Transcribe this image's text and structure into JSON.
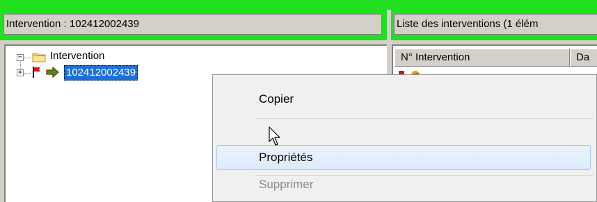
{
  "left_header": {
    "text": "Intervention : 102412002439"
  },
  "right_header": {
    "text": "Liste des interventions  (1 élém"
  },
  "tree": {
    "root_label": "Intervention",
    "child_label": "102412002439"
  },
  "list": {
    "columns": [
      "N° Intervention",
      "Da"
    ]
  },
  "context_menu": {
    "items": [
      {
        "label": "Copier",
        "enabled": true
      },
      {
        "label": "Propriétés",
        "enabled": true
      },
      {
        "label": "Supprimer",
        "enabled": false
      }
    ]
  },
  "icons": {
    "folder": "folder-icon",
    "flag": "red-flag-icon",
    "arrow": "green-arrow-icon",
    "cursor": "mouse-cursor-icon"
  },
  "colors": {
    "accent_green": "#20e020",
    "selection_blue": "#1c6fd9"
  }
}
